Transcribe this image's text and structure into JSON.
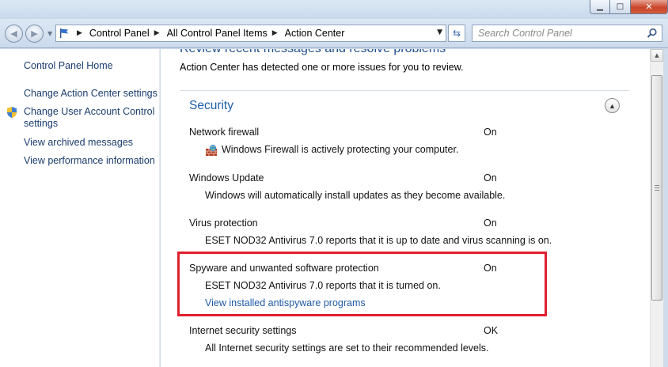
{
  "window": {
    "minimize_label": "▁",
    "maximize_label": "□",
    "close_label": "✕"
  },
  "nav": {
    "breadcrumbs": [
      "Control Panel",
      "All Control Panel Items",
      "Action Center"
    ],
    "search_placeholder": "Search Control Panel"
  },
  "sidebar": {
    "home": "Control Panel Home",
    "links": [
      "Change Action Center settings",
      "Change User Account Control settings",
      "View archived messages",
      "View performance information"
    ]
  },
  "main": {
    "heading": "Review recent messages and resolve problems",
    "intro": "Action Center has detected one or more issues for you to review.",
    "section_title": "Security",
    "items": [
      {
        "name": "Network firewall",
        "status": "On",
        "description": "Windows Firewall is actively protecting your computer."
      },
      {
        "name": "Windows Update",
        "status": "On",
        "description": "Windows will automatically install updates as they become available."
      },
      {
        "name": "Virus protection",
        "status": "On",
        "description": "ESET NOD32 Antivirus 7.0 reports that it is up to date and virus scanning is on."
      },
      {
        "name": "Spyware and unwanted software protection",
        "status": "On",
        "description": "ESET NOD32 Antivirus 7.0 reports that it is turned on.",
        "link": "View installed antispyware programs"
      },
      {
        "name": "Internet security settings",
        "status": "OK",
        "description": "All Internet security settings are set to their recommended levels."
      }
    ]
  },
  "colors": {
    "highlight_box": "#e0202f",
    "link": "#1f5aa6",
    "section_title": "#1e5fa8"
  }
}
